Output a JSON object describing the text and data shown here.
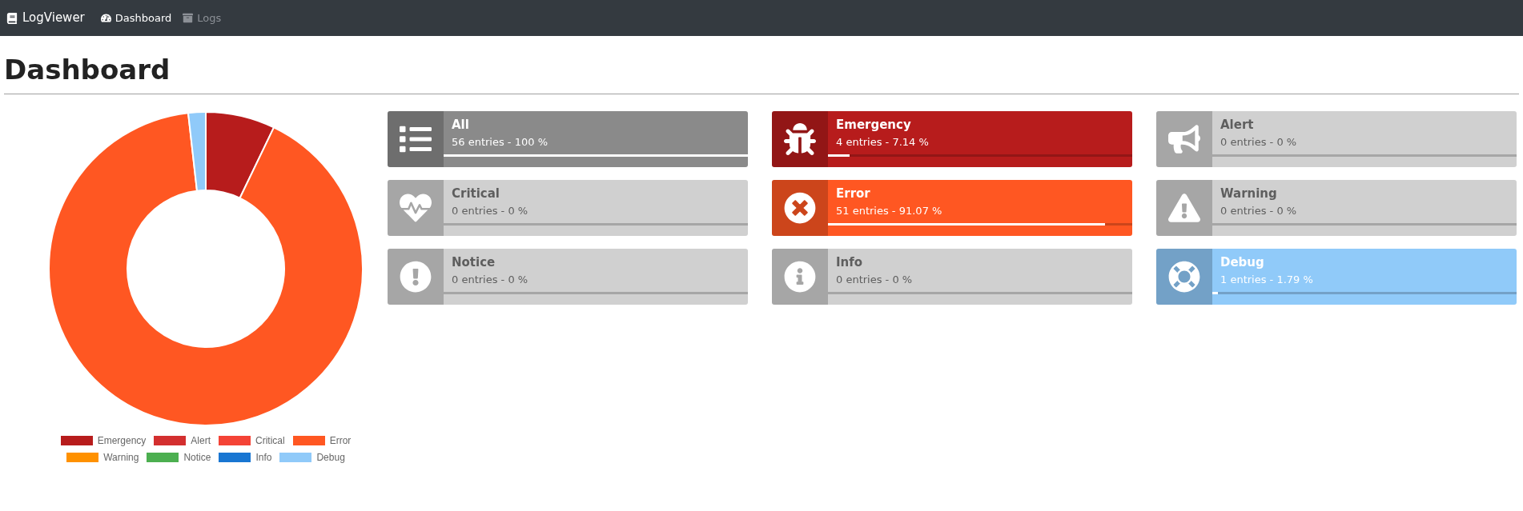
{
  "navbar": {
    "brand": "LogViewer",
    "items": [
      {
        "label": "Dashboard",
        "kind": "dashboard",
        "selected": true
      },
      {
        "label": "Logs",
        "kind": "logs",
        "selected": false
      }
    ]
  },
  "page_title": "Dashboard",
  "chart_data": {
    "type": "donut",
    "categories": [
      "Emergency",
      "Alert",
      "Critical",
      "Error",
      "Warning",
      "Notice",
      "Info",
      "Debug"
    ],
    "colors": [
      "#b71c1c",
      "#d32f2f",
      "#f44336",
      "#ff5722",
      "#ff9100",
      "#4caf50",
      "#1976d2",
      "#90caf9"
    ],
    "values": [
      7.14,
      0,
      0,
      91.07,
      0,
      0,
      0,
      1.79
    ],
    "legend": "bottom"
  },
  "cards": [
    {
      "kind": "all",
      "title": "All",
      "info": "56 entries - 100 %",
      "level": 1,
      "color": "#8a8a8a"
    },
    {
      "kind": "emergency",
      "title": "Emergency",
      "info": "4 entries - 7.14 %",
      "level": 0.0714,
      "color": "#b71c1c"
    },
    {
      "kind": "alert",
      "title": "Alert",
      "info": "0 entries - 0 %",
      "level": 0,
      "color": "#d0d0d0"
    },
    {
      "kind": "critical",
      "title": "Critical",
      "info": "0 entries - 0 %",
      "level": 0,
      "color": "#d0d0d0"
    },
    {
      "kind": "error",
      "title": "Error",
      "info": "51 entries - 91.07 %",
      "level": 0.9107,
      "color": "#ff5722"
    },
    {
      "kind": "warning",
      "title": "Warning",
      "info": "0 entries - 0 %",
      "level": 0,
      "color": "#d0d0d0"
    },
    {
      "kind": "notice",
      "title": "Notice",
      "info": "0 entries - 0 %",
      "level": 0,
      "color": "#d0d0d0"
    },
    {
      "kind": "info",
      "title": "Info",
      "info": "0 entries - 0 %",
      "level": 0,
      "color": "#d0d0d0"
    },
    {
      "kind": "debug",
      "title": "Debug",
      "info": "1 entries - 1.79 %",
      "level": 0.0179,
      "color": "#90caf9"
    }
  ]
}
